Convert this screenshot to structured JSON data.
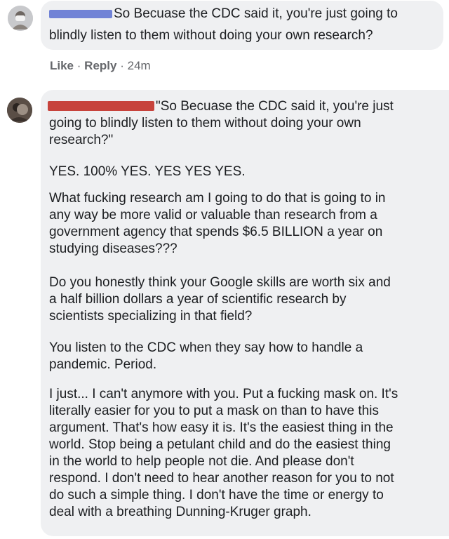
{
  "comment1": {
    "text_line1": "So Becuase the CDC said it, you're just going to",
    "text_line2": "blindly listen to them without doing your own research?",
    "actions": {
      "like": "Like",
      "separator": "·",
      "reply": "Reply",
      "time": "24m"
    }
  },
  "comment2": {
    "quote_line1": "\"So Becuase the CDC said it, you're just",
    "quote_line2": "going to blindly listen to them without doing your own",
    "quote_line3": "research?\"",
    "p1": "YES. 100% YES. YES YES YES.",
    "p2": [
      "What fucking research am I going to do that is going to in",
      "any way be more valid or valuable than research from a",
      "government agency that spends $6.5 BILLION a year on",
      "studying diseases???"
    ],
    "p3": [
      "Do you honestly think your Google skills are worth six and",
      "a half billion dollars a year of scientific research by",
      "scientists specializing in that field?"
    ],
    "p4": [
      "You listen to the CDC when they say how to handle a",
      "pandemic. Period."
    ],
    "p5": [
      "I just... I can't anymore with you. Put a fucking mask on. It's",
      "literally easier for you to put a mask on than to have this",
      "argument. That's how easy it is. It's the easiest thing in the",
      "world. Stop being a petulant child and do the easiest thing",
      "in the world to help people not die. And please don't",
      "respond. I don't need to hear another reason for you to not",
      "do such a simple thing. I don't have the time or energy to",
      "deal with a breathing Dunning-Kruger graph."
    ]
  },
  "colors": {
    "bubble_bg": "#eff0f2",
    "redaction_blue": "#7183d6",
    "redaction_red": "#c7433c",
    "meta_gray": "#65676b"
  }
}
